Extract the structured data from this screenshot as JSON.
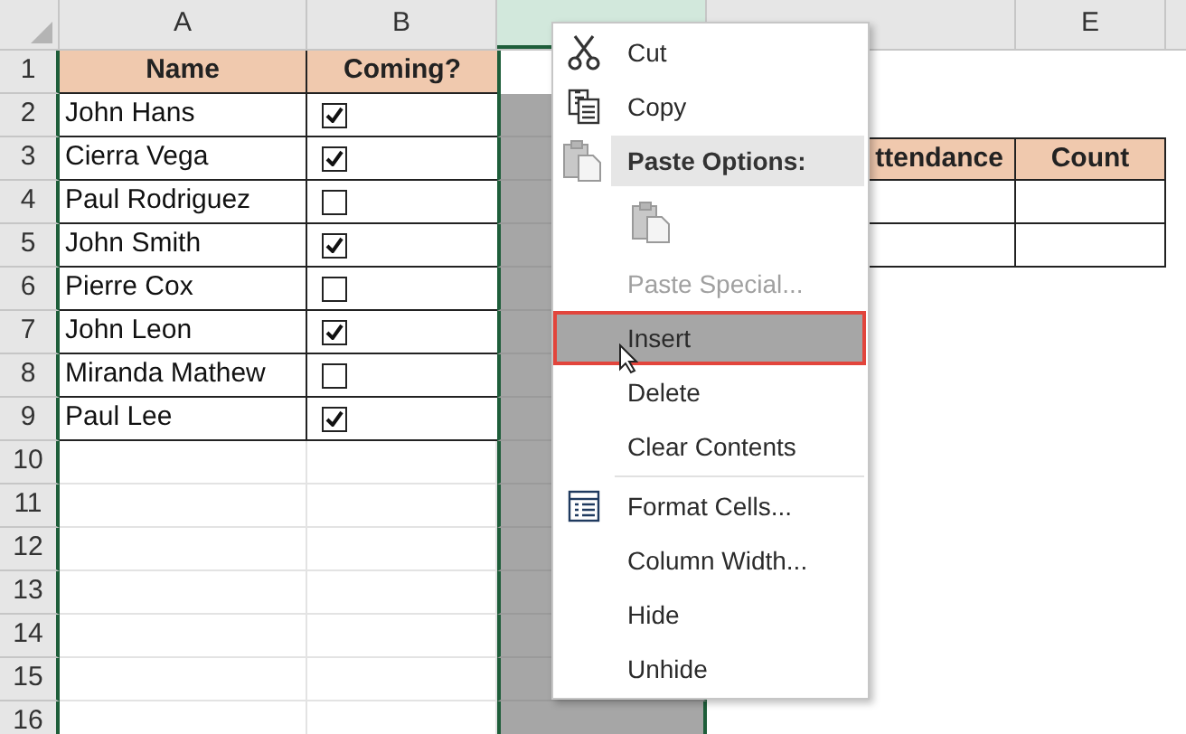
{
  "columns": [
    {
      "label": "A",
      "selected": false
    },
    {
      "label": "B",
      "selected": false
    },
    {
      "selected": true
    },
    {
      "selected": false
    },
    {
      "label": "E",
      "selected": false
    }
  ],
  "row_numbers": [
    "1",
    "2",
    "3",
    "4",
    "5",
    "6",
    "7",
    "8",
    "9",
    "10",
    "11",
    "12",
    "13",
    "14",
    "15",
    "16"
  ],
  "guest_table": {
    "headers": [
      "Name",
      "Coming?"
    ],
    "rows": [
      {
        "name": "John Hans",
        "coming": true
      },
      {
        "name": "Cierra Vega",
        "coming": true
      },
      {
        "name": "Paul Rodriguez",
        "coming": false
      },
      {
        "name": "John Smith",
        "coming": true
      },
      {
        "name": "Pierre Cox",
        "coming": false
      },
      {
        "name": "John Leon",
        "coming": true
      },
      {
        "name": "Miranda Mathew",
        "coming": false
      },
      {
        "name": "Paul Lee",
        "coming": true
      }
    ]
  },
  "summary_table": {
    "headers": [
      "ttendance",
      "Count"
    ]
  },
  "context_menu": {
    "items": [
      {
        "kind": "command",
        "label": "Cut",
        "disabled": false,
        "selected": false
      },
      {
        "kind": "command",
        "label": "Copy",
        "disabled": false,
        "selected": false
      },
      {
        "kind": "header",
        "label": "Paste Options:"
      },
      {
        "kind": "paste_icon"
      },
      {
        "kind": "command",
        "label": "Paste Special...",
        "disabled": true,
        "selected": false
      },
      {
        "kind": "command",
        "label": "Insert",
        "disabled": false,
        "selected": true
      },
      {
        "kind": "command",
        "label": "Delete",
        "disabled": false,
        "selected": false
      },
      {
        "kind": "command",
        "label": "Clear Contents",
        "disabled": false,
        "selected": false
      },
      {
        "kind": "separator"
      },
      {
        "kind": "command",
        "label": "Format Cells...",
        "disabled": false,
        "selected": false
      },
      {
        "kind": "command",
        "label": "Column Width...",
        "disabled": false,
        "selected": false
      },
      {
        "kind": "command",
        "label": "Hide",
        "disabled": false,
        "selected": false
      },
      {
        "kind": "command",
        "label": "Unhide",
        "disabled": false,
        "selected": false
      }
    ]
  }
}
